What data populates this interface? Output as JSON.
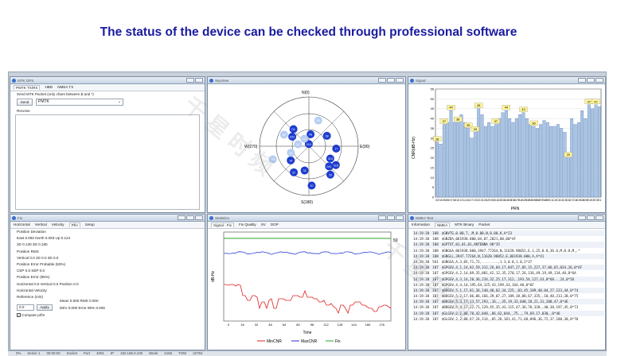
{
  "headline": "The status of the device can be checked through professional software",
  "watermark": "千 星 时 频",
  "colors": {
    "headline": "#1a1aa0",
    "bar": "#a9c4e4",
    "bar_stroke": "#4a6fa5",
    "label_bg": "#fff59a",
    "sat": "#1e3ccf",
    "sat_light": "#b7cdf2",
    "min": "#e02020",
    "max": "#2aa12a",
    "avg": "#3340d8"
  },
  "mtk": {
    "title": "MTK GPS",
    "tabs": [
      "PMTK TX/RX",
      "HBD",
      "NMEA TX"
    ],
    "hint": "Send MTK Packet (only chars between $ and *)",
    "send_label": "Send",
    "command_value": "PMTK",
    "receive_label": "Receive"
  },
  "skyview": {
    "title": "SkyView",
    "north": "N(0)",
    "east": "E(90)",
    "south": "S(180)",
    "west": "W(270)",
    "sats": [
      {
        "id": "013",
        "az": 358,
        "el": 86,
        "used": true
      },
      {
        "id": "022",
        "az": 300,
        "el": 55,
        "used": true
      },
      {
        "id": "D1",
        "az": 318,
        "el": 48,
        "used": true
      },
      {
        "id": "08",
        "az": 60,
        "el": 52,
        "used": true
      },
      {
        "id": "06",
        "az": 8,
        "el": 68,
        "used": true
      },
      {
        "id": "17",
        "az": 95,
        "el": 40,
        "used": true
      },
      {
        "id": "013",
        "az": 120,
        "el": 45,
        "used": true
      },
      {
        "id": "016",
        "az": 125,
        "el": 30,
        "used": true
      },
      {
        "id": "041",
        "az": 135,
        "el": 38,
        "used": true
      },
      {
        "id": "29",
        "az": 143,
        "el": 25,
        "used": true
      },
      {
        "id": "14",
        "az": 232,
        "el": 48,
        "used": true
      },
      {
        "id": "37",
        "az": 210,
        "el": 35,
        "used": true
      },
      {
        "id": "24",
        "az": 250,
        "el": 55,
        "used": false
      },
      {
        "id": "D4",
        "az": 330,
        "el": 74,
        "used": false
      },
      {
        "id": "D5",
        "az": 20,
        "el": 40,
        "used": false
      },
      {
        "id": "10",
        "az": 176,
        "el": 18,
        "used": true
      },
      {
        "id": "03",
        "az": 280,
        "el": 70,
        "used": false
      },
      {
        "id": "34",
        "az": 190,
        "el": 45,
        "used": true
      },
      {
        "id": "B3",
        "az": 250,
        "el": 20,
        "used": false
      },
      {
        "id": "02",
        "az": 295,
        "el": 40,
        "used": false
      }
    ]
  },
  "signal": {
    "title": "Signal",
    "ylabel": "CNR(dB-Hz)",
    "xlabel": "PRN"
  },
  "chart_data": {
    "type": "bar",
    "ylabel": "CNR(dB-Hz)",
    "xlabel": "PRN",
    "ylim": [
      0,
      55
    ],
    "yticks": [
      0,
      5,
      10,
      15,
      20,
      25,
      30,
      35,
      40,
      45,
      50,
      55
    ],
    "categories": [
      "02",
      "04",
      "05",
      "06",
      "07",
      "08",
      "10",
      "13",
      "14",
      "16",
      "17",
      "19",
      "22",
      "24",
      "26",
      "29",
      "30",
      "D1",
      "D2",
      "D3",
      "D4",
      "D5",
      "D6",
      "D7",
      "B1",
      "B2",
      "B3",
      "B4",
      "B5",
      "B6",
      "B7",
      "B8",
      "B9",
      "C1",
      "C2",
      "C3",
      "C4",
      "C5",
      "C6",
      "C7",
      "C8",
      "C9",
      "D8",
      "D9",
      "E1",
      "E2",
      "E3",
      "E4"
    ],
    "values": [
      28,
      27,
      37,
      38,
      44,
      38,
      38,
      42,
      38,
      35,
      30,
      33,
      45,
      42,
      36,
      38,
      36,
      37,
      40,
      43,
      44,
      40,
      38,
      40,
      42,
      43,
      40,
      37,
      36,
      35,
      37,
      39,
      38,
      36,
      36,
      37,
      35,
      33,
      20,
      40,
      37,
      38,
      44,
      40,
      47,
      45,
      47,
      46
    ],
    "labels": [
      {
        "cat": "02",
        "text": "28"
      },
      {
        "cat": "05",
        "text": "37"
      },
      {
        "cat": "07",
        "text": "44"
      },
      {
        "cat": "10",
        "text": "38"
      },
      {
        "cat": "16",
        "text": "35"
      },
      {
        "cat": "19",
        "text": "33"
      },
      {
        "cat": "22",
        "text": "45"
      },
      {
        "cat": "D1",
        "text": "37"
      },
      {
        "cat": "D4",
        "text": "44"
      },
      {
        "cat": "B2",
        "text": "43"
      },
      {
        "cat": "B5",
        "text": "36"
      },
      {
        "cat": "C6",
        "text": "20"
      },
      {
        "cat": "E1",
        "text": "47"
      },
      {
        "cat": "E3",
        "text": "47"
      }
    ]
  },
  "fix": {
    "title": "Fix",
    "tabs": [
      "Horizontal",
      "Vertical",
      "Velocity",
      "Pfm",
      "Setup"
    ],
    "rows": [
      {
        "text": "Position Deviation"
      },
      {
        "text": "East 0.092      North 0.093      Up 0.124"
      },
      {
        "text": "2D  0.130      3D  0.180"
      },
      {
        "text": "Position RMS"
      },
      {
        "text": "Vertical 0.0      2D 0.0      3D 0.0"
      },
      {
        "text": "Position Error Probable (50%)"
      },
      {
        "text": "CEP  0.0      SEP  0.0"
      },
      {
        "text": "Position Error (95%)"
      },
      {
        "text": "Horizontal 0.0      Vertical 0.0      Position 0.0"
      },
      {
        "text": "Horizontal Velocity"
      },
      {
        "text": "Reference (m/s)"
      }
    ],
    "ref_value": "0.0",
    "apply_label": "Apply",
    "stats": "Mean  0.000      RMS  0.000",
    "stats2": "DEV  0.000      Error 95%  0.000",
    "checkbox_label": "Compute prfm"
  },
  "statistics": {
    "title": "Statistics",
    "tabs": [
      "Signal - Fix",
      "Fix Quality",
      "SV",
      "DOP"
    ],
    "ylabel": "dB-Hz",
    "xlabel": "Time",
    "xticks": [
      "0",
      "16",
      "32",
      "48",
      "64",
      "80",
      "96",
      "112",
      "128",
      "144",
      "160",
      "176"
    ],
    "right_label": "50",
    "legend": [
      "MinCNR",
      "MaxCNR",
      "Fix"
    ]
  },
  "nmea": {
    "title": "NMEA Text",
    "tabs": [
      "Information",
      "NMEA",
      "MTK Binary",
      "Packet"
    ],
    "rows": [
      {
        "time": "14:19:38",
        "n": "188",
        "text": "$GNVTG,0.00,T,,M,0.00,N,0.00,K,A*23"
      },
      {
        "time": "14:19:38",
        "n": "188",
        "text": "$GNZDA,061938.000,04,07,2021,00,00*4F"
      },
      {
        "time": "14:19:38",
        "n": "188",
        "text": "$GPTXT,01,01,01,ANTENNA OK*35"
      },
      {
        "time": "14:19:38",
        "n": "188",
        "text": "$GNGGA,061938.000,3947.77264,N,11628.98052,E,1,25,0.8,36.6,M,0.0,M,,*"
      },
      {
        "time": "14:19:38",
        "n": "188",
        "text": "$GNGLL,3947.77264,N,11628.98052,E,061938.000,A,A*41"
      },
      {
        "time": "14:19:38",
        "n": "561",
        "text": "$GNGSA,A,3,05,71,72,........,1.3,0.8,1.0,2*37"
      },
      {
        "time": "14:19:38",
        "n": "187",
        "text": "$GPGSV,4,1,14,02,59,312,26,04,17,047,27,05,15,227,37,06,65,034,26,0*6F"
      },
      {
        "time": "14:19:38",
        "n": "187",
        "text": "$GPGSV,4,2,14,09,35,081,42,12,35,270,17,26,136,49,19,49,134,48,0*6A"
      },
      {
        "time": "14:19:38",
        "n": "187",
        "text": "$GPGSV,4,3,14,20,36,234,32,25,17,312,,193,54,127,43,0*68...24,0*56"
      },
      {
        "time": "14:19:38",
        "n": "187",
        "text": "$GPGSV,4,4,14,195,64,125,43,199,43,164,40,0*6F"
      },
      {
        "time": "14:19:38",
        "n": "187",
        "text": "$BDGSV,5,1,17,01,36,140,40,02,34,225,,03,45,189,40,04,27,123,44,0*74"
      },
      {
        "time": "14:19:38",
        "n": "187",
        "text": "$BDGSV,5,2,17,06,06,166,39,07,27,189,38,08,67,335,,10,40,213,38,0*75"
      },
      {
        "time": "14:19:38",
        "n": "187",
        "text": "$BDGSV,5,3,17,13,57,293,,16,,,35,19,33,048,18,21,31,200,47,0*4E"
      },
      {
        "time": "14:19:38",
        "n": "187",
        "text": "$BDGSV,5,4,17,22,71,129,45,35,43,115,47,36,70,328,,40,38,197,45,0*73"
      },
      {
        "time": "14:19:38",
        "n": "187",
        "text": "$GLGSV,2,1,08,70,42,048,,86,62,044,,75,,,79,69,17,030,,0*46"
      },
      {
        "time": "14:19:38",
        "n": "187",
        "text": "$GLGSV,2,2,08,67,24,314,,85,26,101,41,71,68,096,36,72,37,180,38,0*70"
      }
    ]
  },
  "statusbar": [
    "0%",
    "Serial: 1",
    "00:00:00",
    "Socket",
    "Port",
    "4001",
    "IP",
    "192.168.0.100",
    "Week",
    "2165",
    "TOW",
    "22784"
  ]
}
